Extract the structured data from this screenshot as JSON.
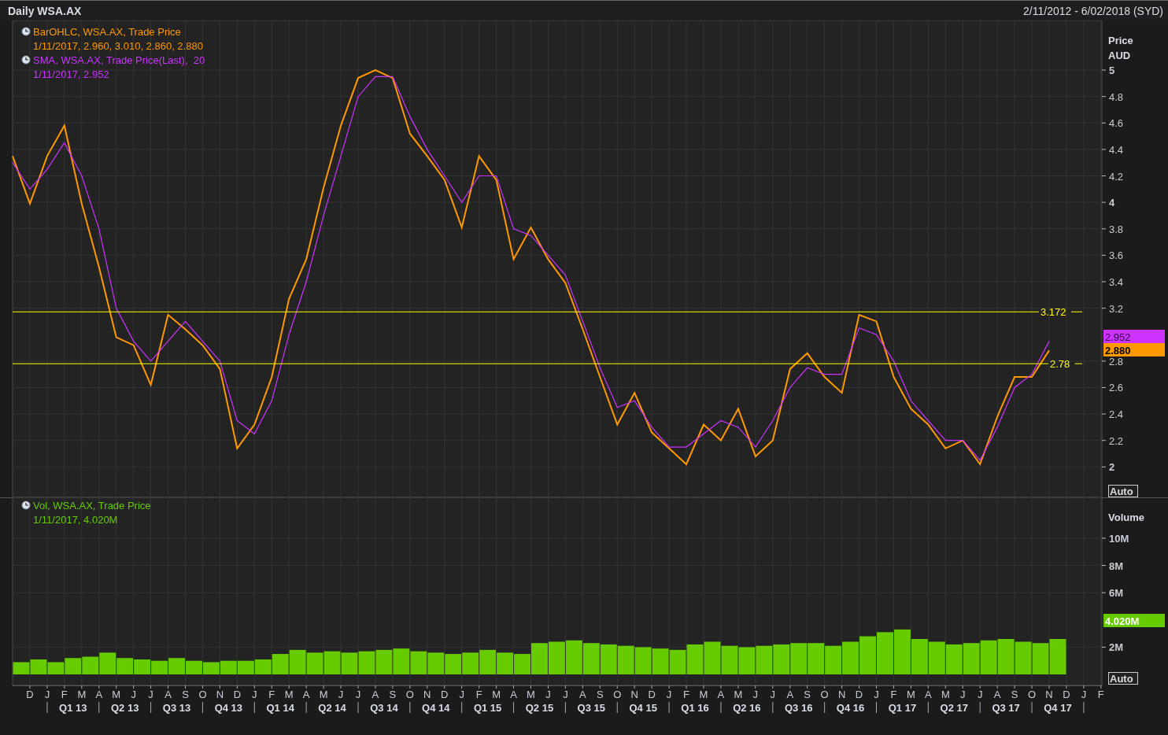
{
  "header": {
    "title": "Daily WSA.AX",
    "date_range": "2/11/2012 - 6/02/2018 (SYD)"
  },
  "price_panel": {
    "axis_title": "Price",
    "axis_unit": "AUD",
    "auto_label": "Auto",
    "legend": [
      {
        "values": "1/11/2017, 2.960, 3.010, 2.860, 2.880"
      },
      {
        "values": "1/11/2017, 2.952"
      }
    ],
    "tags": [
      {
        "text": "2.952",
        "color": "#cc33ff"
      },
      {
        "text": "2.880",
        "color": "#ff9900"
      }
    ],
    "chart_data": {
      "type": "line",
      "series": [
        {
          "name": "BarOHLC, WSA.AX, Trade Price",
          "color": "#ff9900",
          "values": [
            4.35,
            3.99,
            4.35,
            4.58,
            3.99,
            3.51,
            2.98,
            2.92,
            2.62,
            3.15,
            3.04,
            2.92,
            2.74,
            2.14,
            2.32,
            2.68,
            3.27,
            3.57,
            4.11,
            4.58,
            4.94,
            5.0,
            4.94,
            4.52,
            4.35,
            4.17,
            3.81,
            4.35,
            4.17,
            3.57,
            3.81,
            3.57,
            3.39,
            3.04,
            2.68,
            2.32,
            2.56,
            2.26,
            2.14,
            2.02,
            2.32,
            2.2,
            2.44,
            2.08,
            2.2,
            2.74,
            2.86,
            2.68,
            2.56,
            3.15,
            3.1,
            2.68,
            2.44,
            2.32,
            2.14,
            2.2,
            2.02,
            2.38,
            2.68,
            2.68,
            2.88
          ]
        },
        {
          "name": "SMA, WSA.AX, Trade Price(Last),  20",
          "color": "#cc33ff",
          "values": [
            4.3,
            4.1,
            4.25,
            4.45,
            4.2,
            3.8,
            3.2,
            2.95,
            2.8,
            2.95,
            3.1,
            2.95,
            2.8,
            2.35,
            2.25,
            2.5,
            3.0,
            3.4,
            3.9,
            4.35,
            4.8,
            4.95,
            4.95,
            4.65,
            4.4,
            4.2,
            4.0,
            4.2,
            4.2,
            3.8,
            3.75,
            3.6,
            3.45,
            3.1,
            2.75,
            2.45,
            2.5,
            2.3,
            2.15,
            2.15,
            2.25,
            2.35,
            2.3,
            2.15,
            2.35,
            2.6,
            2.75,
            2.7,
            2.7,
            3.05,
            3.0,
            2.8,
            2.5,
            2.35,
            2.2,
            2.2,
            2.05,
            2.3,
            2.6,
            2.7,
            2.95
          ]
        }
      ],
      "ylim": [
        1.77,
        5.375
      ],
      "yticks": [
        2,
        2.2,
        2.4,
        2.6,
        2.8,
        3.2,
        3.4,
        3.6,
        3.8,
        4,
        4.2,
        4.4,
        4.6,
        4.8,
        5
      ],
      "ref_lines": [
        {
          "axis": "y",
          "value": 3.172,
          "label": "3.172"
        },
        {
          "axis": "y",
          "value": 2.78,
          "label": "2.78"
        }
      ]
    }
  },
  "volume_panel": {
    "auto_label": "Auto",
    "legend": [
      {
        "values": "1/11/2017, 4.020M"
      }
    ],
    "tags": [
      {
        "text": "4.020M",
        "color": "#66cc00"
      }
    ],
    "chart_data": {
      "type": "bar",
      "ylabel": "Volume",
      "series": [
        {
          "name": "Vol, WSA.AX, Trade Price",
          "color": "#66cc00",
          "values": [
            0.9,
            1.1,
            0.9,
            1.2,
            1.3,
            1.6,
            1.2,
            1.1,
            1.0,
            1.2,
            1.0,
            0.9,
            1.0,
            1.0,
            1.1,
            1.5,
            1.8,
            1.6,
            1.7,
            1.6,
            1.7,
            1.8,
            1.9,
            1.7,
            1.6,
            1.5,
            1.6,
            1.8,
            1.6,
            1.5,
            2.3,
            2.4,
            2.5,
            2.3,
            2.2,
            2.1,
            2.0,
            1.9,
            1.8,
            2.2,
            2.4,
            2.1,
            2.0,
            2.1,
            2.2,
            2.3,
            2.3,
            2.1,
            2.4,
            2.8,
            3.1,
            3.3,
            2.6,
            2.4,
            2.2,
            2.3,
            2.5,
            2.6,
            2.4,
            2.3,
            2.6
          ]
        }
      ],
      "ylim": [
        0,
        13
      ],
      "yticks": [
        {
          "value": 2,
          "label": "2M"
        },
        {
          "value": 6,
          "label": "6M"
        },
        {
          "value": 8,
          "label": "8M"
        },
        {
          "value": 10,
          "label": "10M"
        }
      ]
    }
  },
  "time_axis": {
    "months": [
      "D",
      "J",
      "F",
      "M",
      "A",
      "M",
      "J",
      "J",
      "A",
      "S",
      "O",
      "N",
      "D",
      "J",
      "F",
      "M",
      "A",
      "M",
      "J",
      "J",
      "A",
      "S",
      "O",
      "N",
      "D",
      "J",
      "F",
      "M",
      "A",
      "M",
      "J",
      "J",
      "A",
      "S",
      "O",
      "N",
      "D",
      "J",
      "F",
      "M",
      "A",
      "M",
      "J",
      "J",
      "A",
      "S",
      "O",
      "N",
      "D",
      "J",
      "F",
      "M",
      "A",
      "M",
      "J",
      "J",
      "A",
      "S",
      "O",
      "N",
      "D",
      "J",
      "F"
    ],
    "quarters": [
      "Q1 13",
      "Q2 13",
      "Q3 13",
      "Q4 13",
      "Q1 14",
      "Q2 14",
      "Q3 14",
      "Q4 14",
      "Q1 15",
      "Q2 15",
      "Q3 15",
      "Q4 15",
      "Q1 16",
      "Q2 16",
      "Q3 16",
      "Q4 16",
      "Q1 17",
      "Q2 17",
      "Q3 17",
      "Q4 17"
    ]
  }
}
